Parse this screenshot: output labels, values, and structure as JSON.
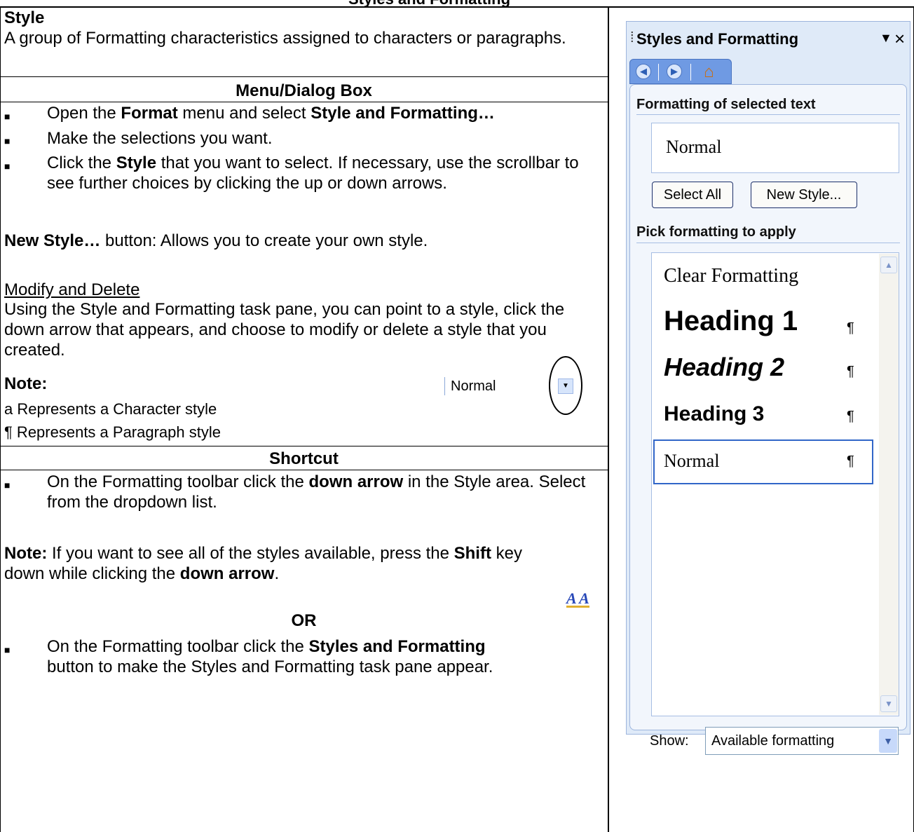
{
  "doc": {
    "title": "Styles and Formatting",
    "style_label": "Style",
    "style_def": "A group of Formatting characteristics assigned to characters or paragraphs.",
    "menu_header": "Menu/Dialog Box",
    "menu_items": [
      {
        "pre": "Open the ",
        "b1": "Format",
        "mid": " menu and select ",
        "b2": "Style and Formatting…"
      },
      {
        "text": "Make the selections you want."
      },
      {
        "pre": "Click the ",
        "b1": "Style",
        "post": " that you want to select. If necessary, use the scrollbar to see further choices by clicking the up or down arrows."
      }
    ],
    "new_style_b": "New Style…",
    "new_style_rest": " button:  Allows you to create your own style.",
    "modify_title": "Modify and Delete",
    "modify_text": "Using the Style and Formatting task pane, you can point to a style, click the down arrow that appears, and choose to modify or delete a style that you created.",
    "note_label": "Note:",
    "note_char": "a Represents a Character style",
    "note_para": "¶ Represents a Paragraph style",
    "shortcut_header": "Shortcut",
    "sc1_pre": "On the Formatting toolbar click the ",
    "sc1_b": "down arrow",
    "sc1_post": " in the Style area.  Select from the dropdown list.",
    "sample_style": "Normal",
    "note2_b": "Note:",
    "note2_t1": "  If you want to see all of the styles available, press the ",
    "note2_b2": "Shift",
    "note2_t2": " key down while clicking the ",
    "note2_b3": "down arrow",
    "note2_t3": ".",
    "or": "OR",
    "sc2_pre": "On the Formatting toolbar click the ",
    "sc2_b": "Styles and Formatting",
    "sc2_post": " button to make the Styles and Formatting task pane appear."
  },
  "pane": {
    "title": "Styles and Formatting",
    "section1": "Formatting of selected text",
    "selected": "Normal",
    "btn_select_all": "Select All",
    "btn_new_style": "New Style...",
    "section2": "Pick formatting to apply",
    "items": [
      "Clear Formatting",
      "Heading 1",
      "Heading 2",
      "Heading 3",
      "Normal"
    ],
    "show_label": "Show:",
    "show_value": "Available formatting"
  }
}
